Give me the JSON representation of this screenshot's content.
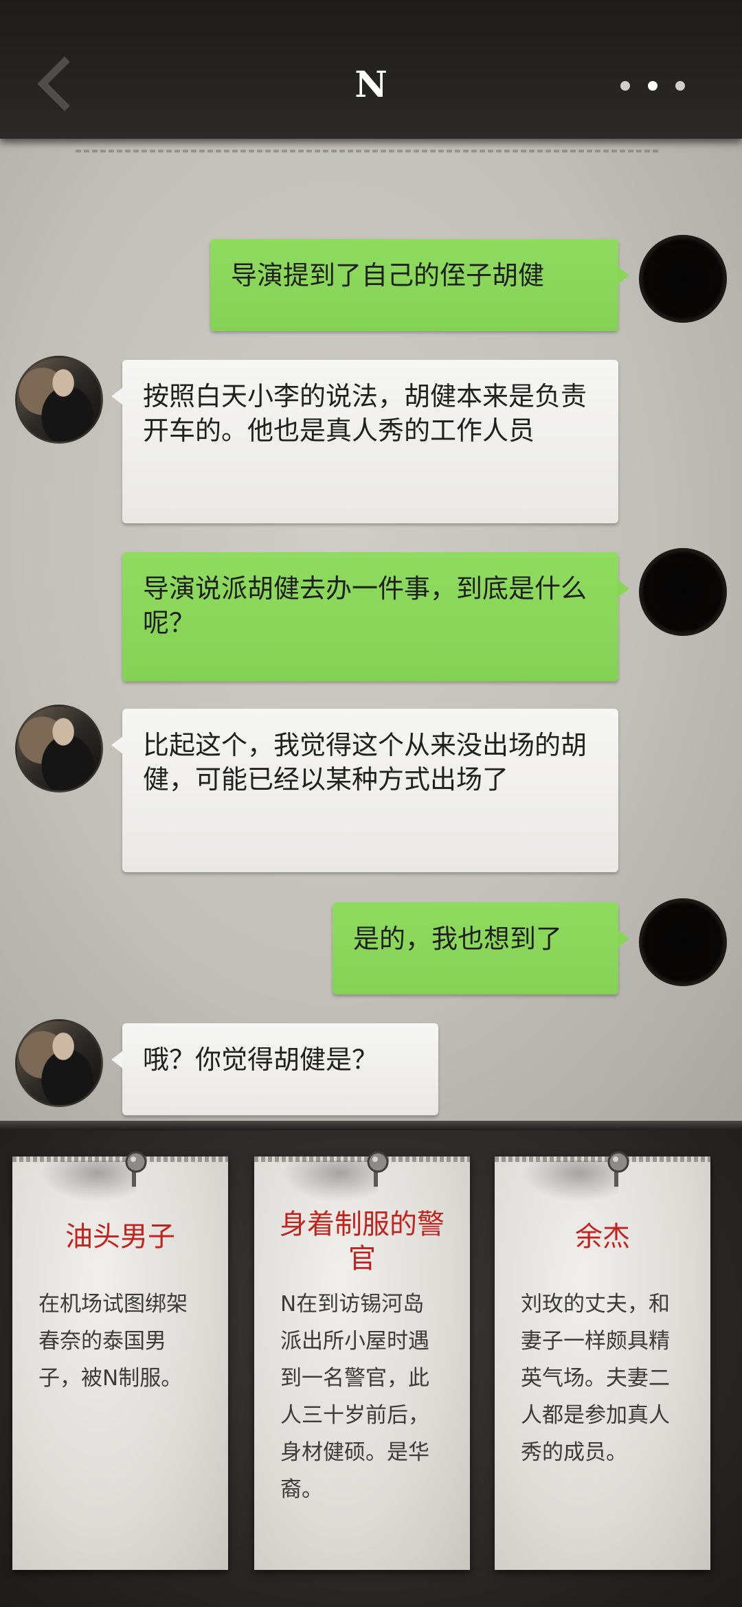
{
  "header": {
    "title": "N"
  },
  "messages": [
    {
      "sender": "self",
      "text": "导演提到了自己的侄子胡健"
    },
    {
      "sender": "N",
      "text": "按照白天小李的说法，胡健本来是负责开车的。他也是真人秀的工作人员"
    },
    {
      "sender": "self",
      "text": "导演说派胡健去办一件事，到底是什么呢？"
    },
    {
      "sender": "N",
      "text": "比起这个，我觉得这个从来没出场的胡健，可能已经以某种方式出场了"
    },
    {
      "sender": "self",
      "text": "是的，我也想到了"
    },
    {
      "sender": "N",
      "text": "哦？你觉得胡健是？"
    }
  ],
  "cards": [
    {
      "title": "油头男子",
      "description": "在机场试图绑架春奈的泰国男子，被N制服。"
    },
    {
      "title": "身着制服的警官",
      "description": "N在到访锡河岛派出所小屋时遇到一名警官，此人三十岁前后，身材健硕。是华裔。"
    },
    {
      "title": "余杰",
      "description": "刘玫的丈夫，和妻子一样颇具精英气场。夫妻二人都是参加真人秀的成员。"
    }
  ],
  "colors": {
    "self_bubble": "#88d658",
    "n_bubble": "#f3f3f1",
    "card_title": "#c0241e",
    "header_bg": "#242322"
  },
  "icons": {
    "back": "chevron-left-icon",
    "more": "more-dots-icon",
    "pin": "pushpin-icon"
  }
}
